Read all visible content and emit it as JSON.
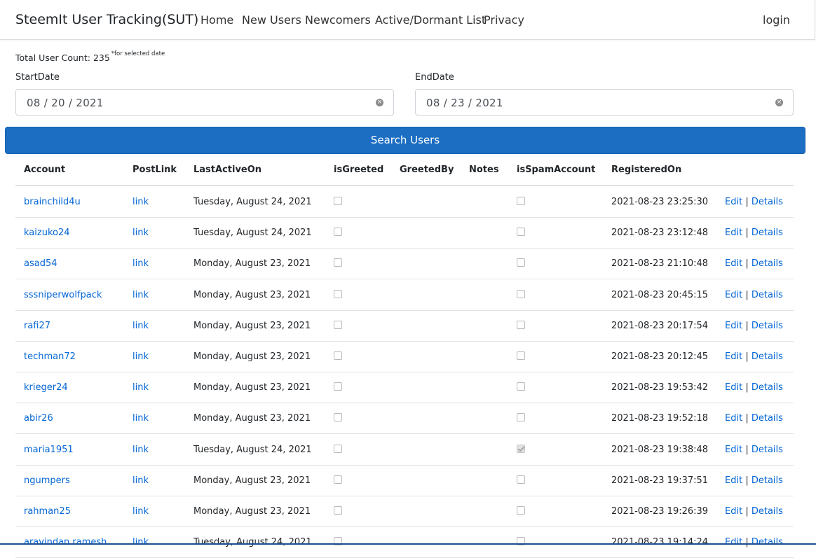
{
  "nav": {
    "brand": "SteemIt User Tracking(SUT)",
    "links": [
      "Home",
      "New Users",
      "Newcomers",
      "Active/Dormant List",
      "Privacy"
    ],
    "login": "login"
  },
  "summary": {
    "total_label": "Total User Count: 235",
    "note": "*for selected date"
  },
  "filters": {
    "start_label": "StartDate",
    "start_value": "08 / 20 / 2021",
    "end_label": "EndDate",
    "end_value": "08 / 23 / 2021",
    "clear_icon": "clear-circle-icon",
    "search_button": "Search Users"
  },
  "colors": {
    "accent": "#1b6ec2",
    "link": "#0366d6"
  },
  "table": {
    "headers": [
      "Account",
      "PostLink",
      "LastActiveOn",
      "isGreeted",
      "GreetedBy",
      "Notes",
      "isSpamAccount",
      "RegisteredOn",
      ""
    ],
    "link_text": "link",
    "edit_text": "Edit",
    "separator": "|",
    "details_text": "Details",
    "rows": [
      {
        "account": "brainchild4u",
        "last_active": "Tuesday, August 24, 2021",
        "is_greeted": false,
        "is_spam": false,
        "registered": "2021-08-23 23:25:30"
      },
      {
        "account": "kaizuko24",
        "last_active": "Tuesday, August 24, 2021",
        "is_greeted": false,
        "is_spam": false,
        "registered": "2021-08-23 23:12:48"
      },
      {
        "account": "asad54",
        "last_active": "Monday, August 23, 2021",
        "is_greeted": false,
        "is_spam": false,
        "registered": "2021-08-23 21:10:48"
      },
      {
        "account": "sssniperwolfpack",
        "last_active": "Monday, August 23, 2021",
        "is_greeted": false,
        "is_spam": false,
        "registered": "2021-08-23 20:45:15"
      },
      {
        "account": "rafi27",
        "last_active": "Monday, August 23, 2021",
        "is_greeted": false,
        "is_spam": false,
        "registered": "2021-08-23 20:17:54"
      },
      {
        "account": "techman72",
        "last_active": "Monday, August 23, 2021",
        "is_greeted": false,
        "is_spam": false,
        "registered": "2021-08-23 20:12:45"
      },
      {
        "account": "krieger24",
        "last_active": "Monday, August 23, 2021",
        "is_greeted": false,
        "is_spam": false,
        "registered": "2021-08-23 19:53:42"
      },
      {
        "account": "abir26",
        "last_active": "Monday, August 23, 2021",
        "is_greeted": false,
        "is_spam": false,
        "registered": "2021-08-23 19:52:18"
      },
      {
        "account": "maria1951",
        "last_active": "Tuesday, August 24, 2021",
        "is_greeted": false,
        "is_spam": true,
        "registered": "2021-08-23 19:38:48"
      },
      {
        "account": "ngumpers",
        "last_active": "Monday, August 23, 2021",
        "is_greeted": false,
        "is_spam": false,
        "registered": "2021-08-23 19:37:51"
      },
      {
        "account": "rahman25",
        "last_active": "Monday, August 23, 2021",
        "is_greeted": false,
        "is_spam": false,
        "registered": "2021-08-23 19:26:39"
      },
      {
        "account": "aravindan.ramesh",
        "last_active": "Tuesday, August 24, 2021",
        "is_greeted": false,
        "is_spam": false,
        "registered": "2021-08-23 19:14:24"
      }
    ]
  }
}
